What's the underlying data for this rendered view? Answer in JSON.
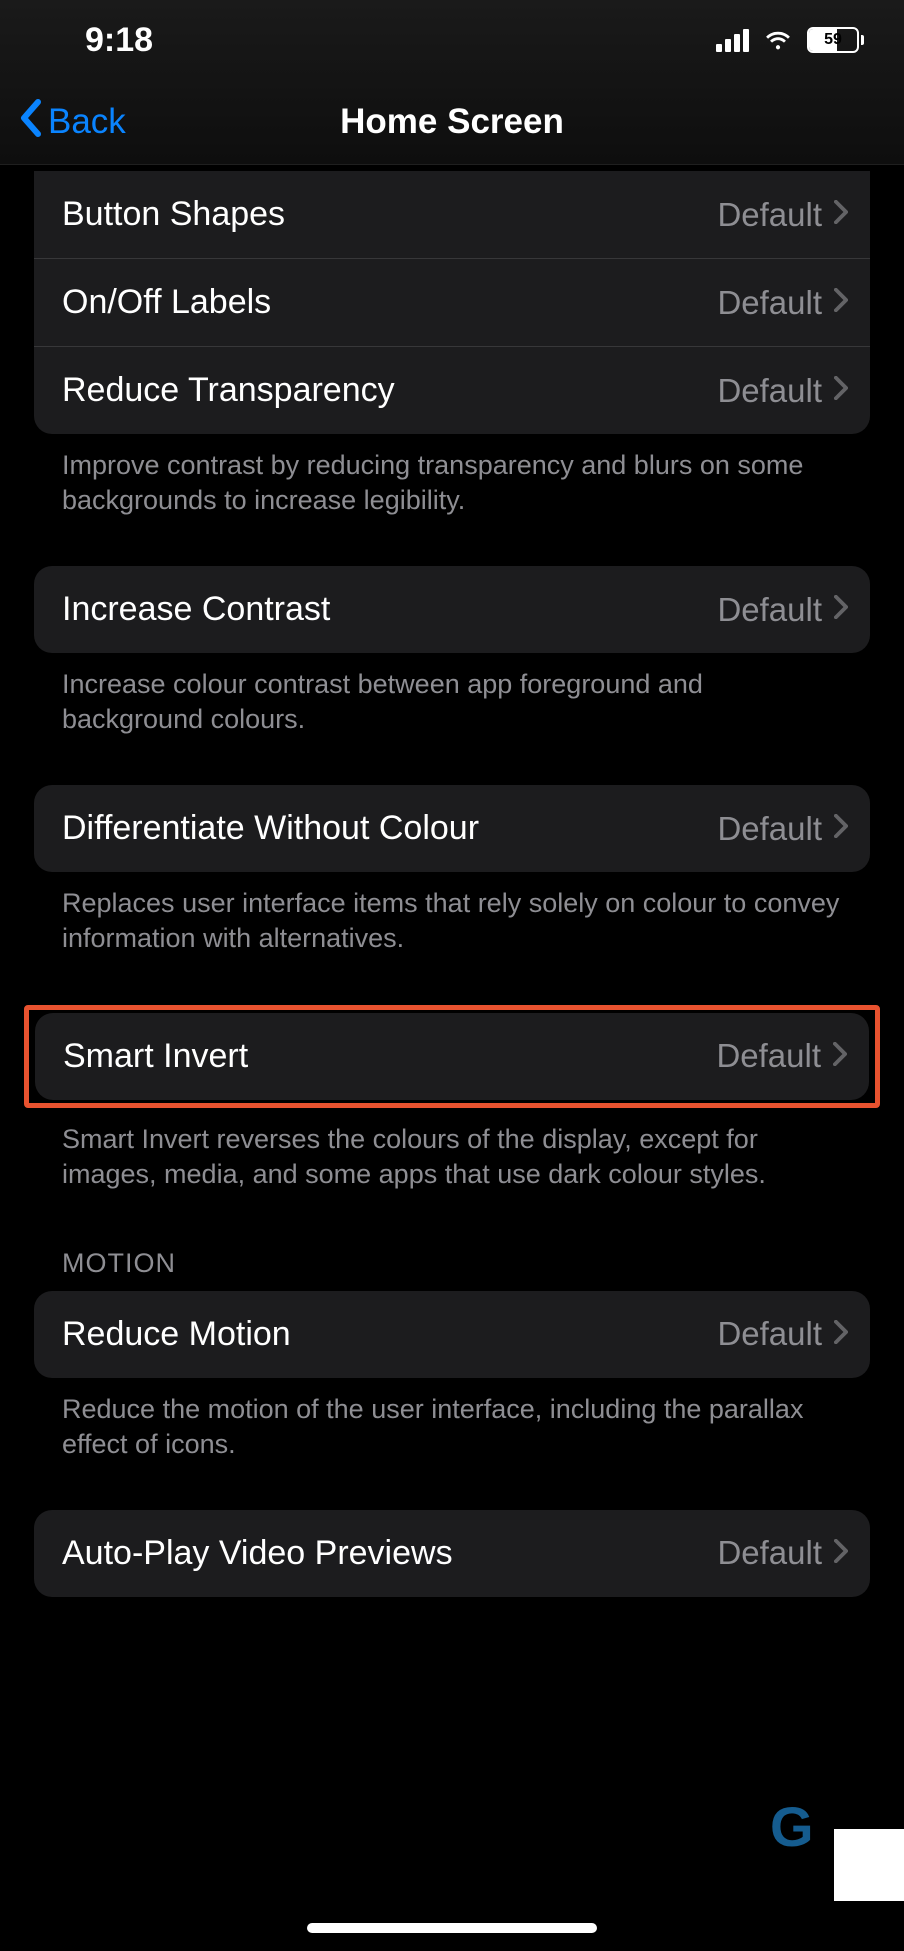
{
  "status": {
    "time": "9:18",
    "battery_percent": "59"
  },
  "nav": {
    "back_label": "Back",
    "title": "Home Screen"
  },
  "groups": {
    "top": [
      {
        "label": "Button Shapes",
        "value": "Default"
      },
      {
        "label": "On/Off Labels",
        "value": "Default"
      },
      {
        "label": "Reduce Transparency",
        "value": "Default"
      }
    ],
    "top_footer": "Improve contrast by reducing transparency and blurs on some backgrounds to increase legibility.",
    "contrast": {
      "label": "Increase Contrast",
      "value": "Default"
    },
    "contrast_footer": "Increase colour contrast between app foreground and background colours.",
    "diff": {
      "label": "Differentiate Without Colour",
      "value": "Default"
    },
    "diff_footer": "Replaces user interface items that rely solely on colour to convey information with alternatives.",
    "invert": {
      "label": "Smart Invert",
      "value": "Default"
    },
    "invert_footer": "Smart Invert reverses the colours of the display, except for images, media, and some apps that use dark colour styles.",
    "motion_header": "MOTION",
    "motion": {
      "label": "Reduce Motion",
      "value": "Default"
    },
    "motion_footer": "Reduce the motion of the user interface, including the parallax effect of icons.",
    "autoplay": {
      "label": "Auto-Play Video Previews",
      "value": "Default"
    }
  }
}
